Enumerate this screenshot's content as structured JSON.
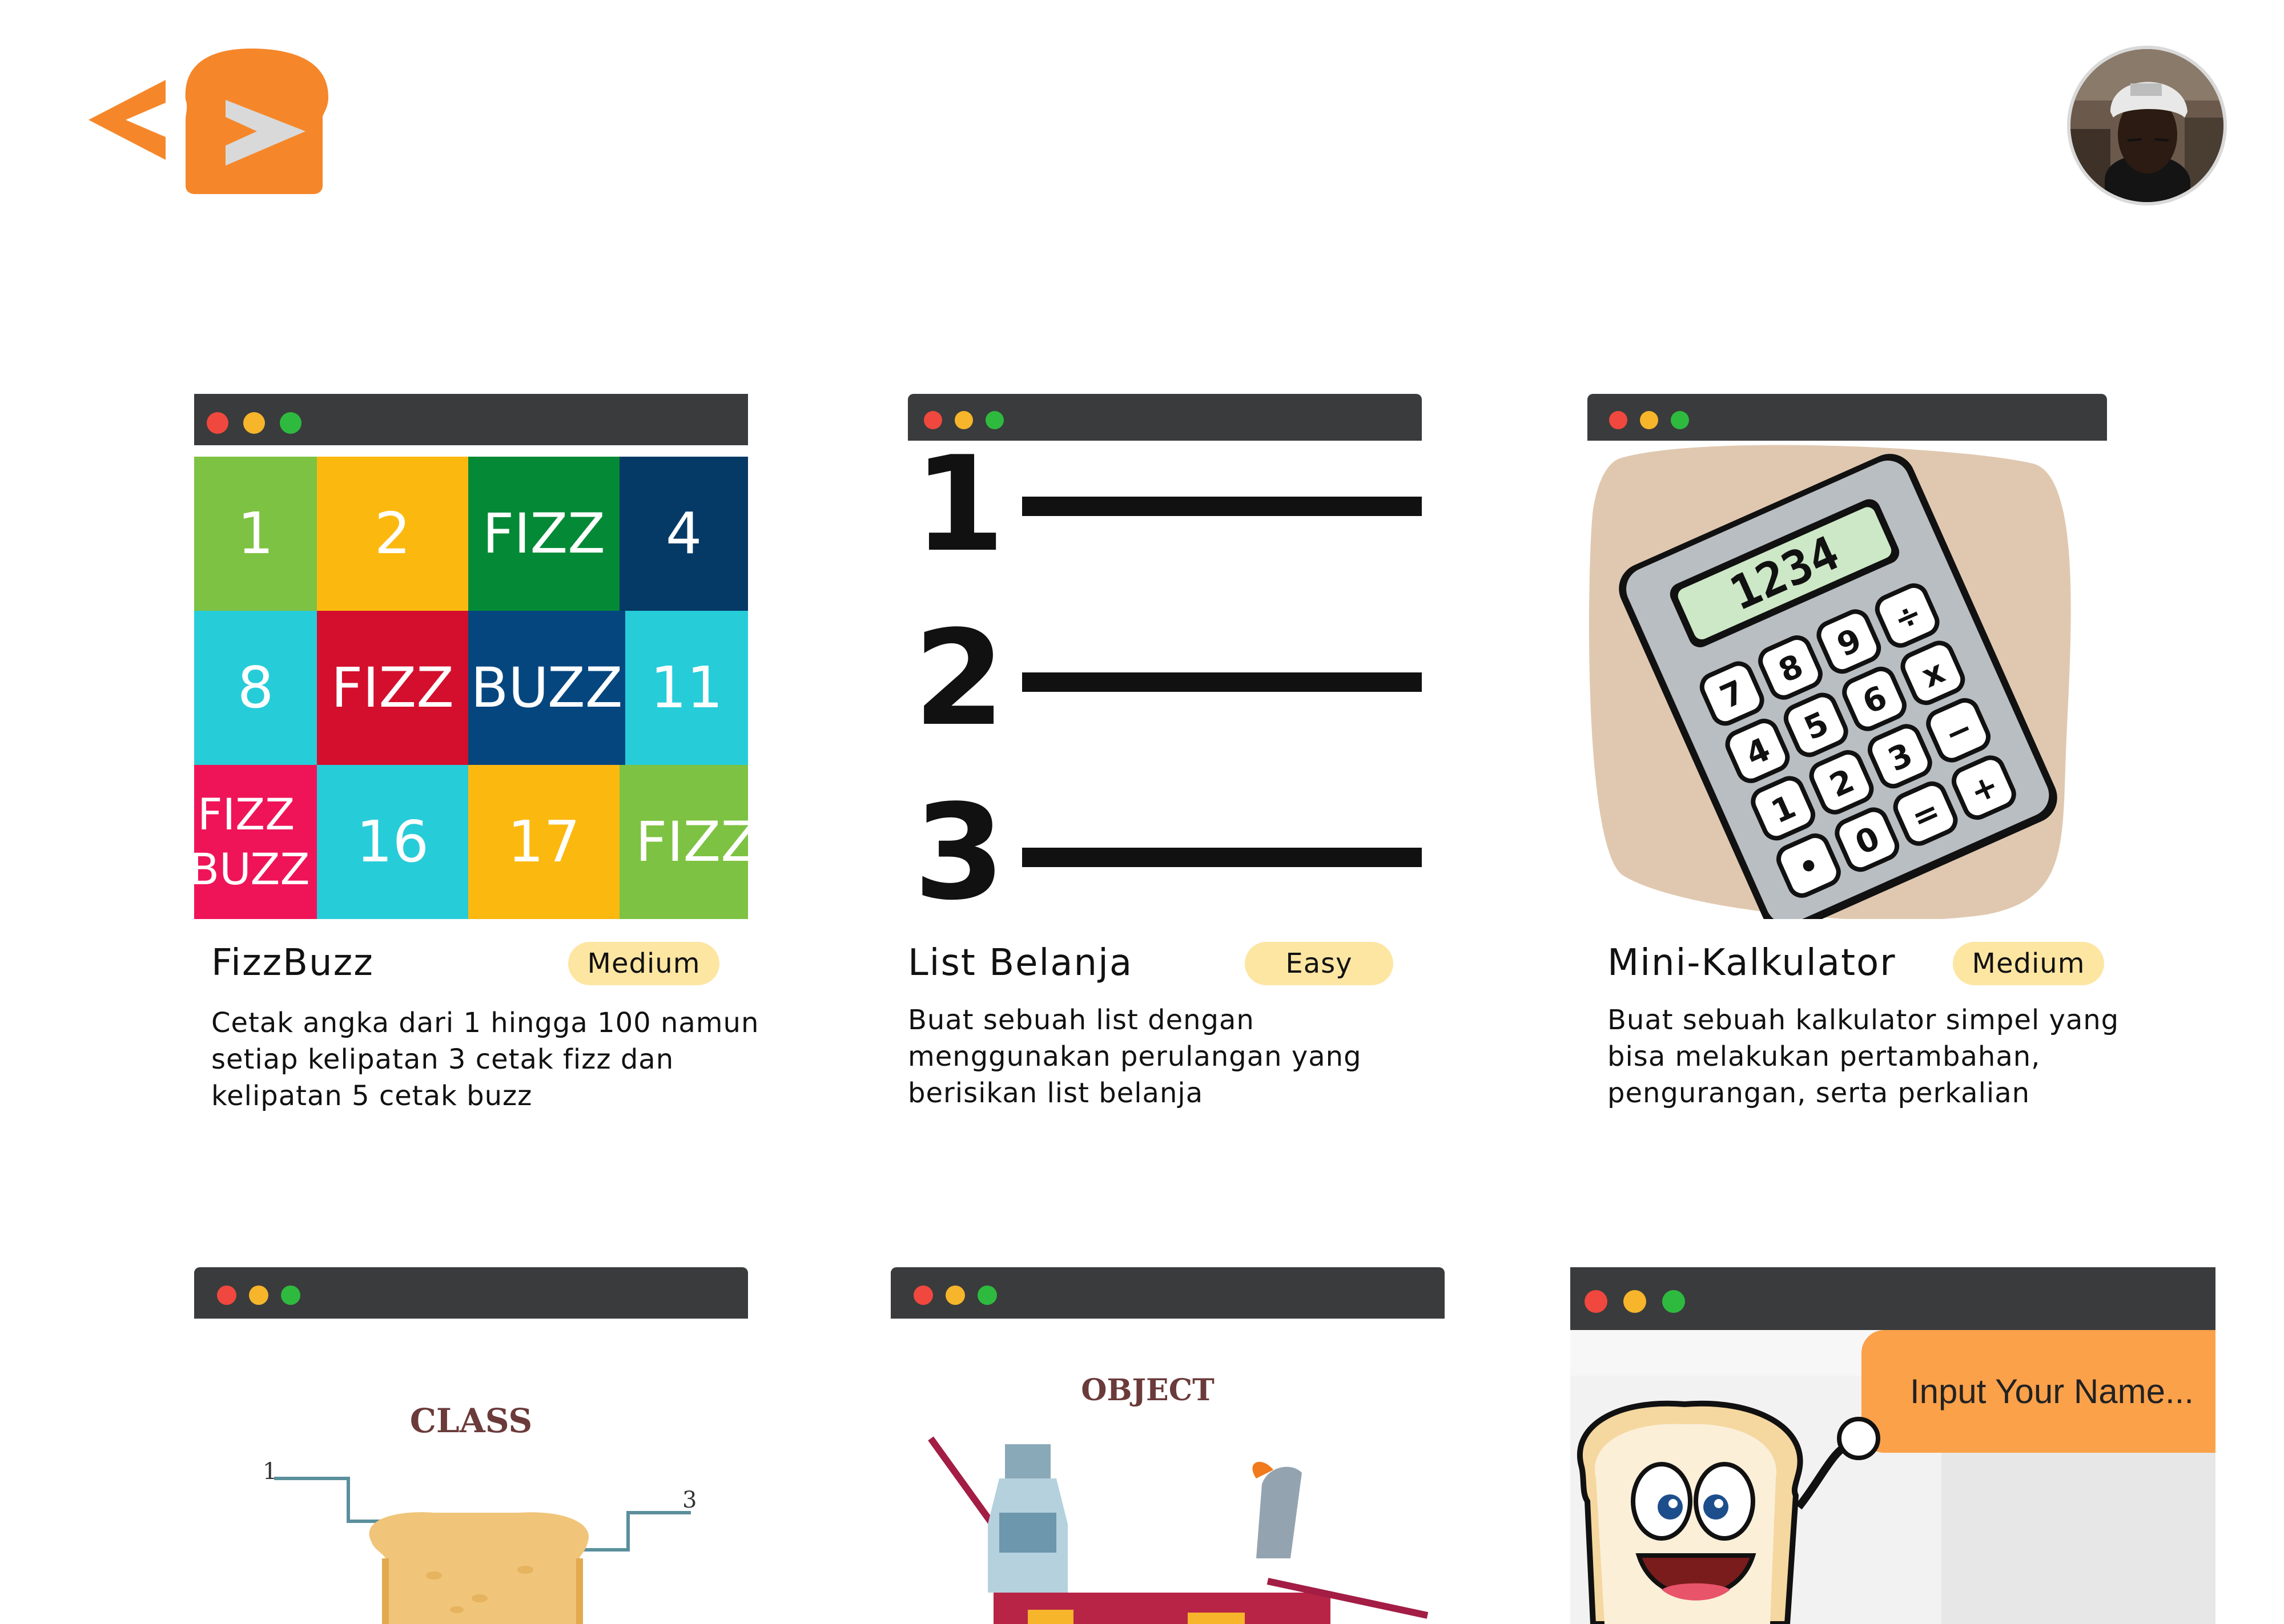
{
  "header": {
    "logo_icon": "code-bread-logo",
    "avatar_icon": "user-avatar"
  },
  "cards": [
    {
      "title": "FizzBuzz",
      "difficulty": "Medium",
      "description_lines": [
        "Cetak angka dari 1 hingga 100 namun",
        "setiap kelipatan 3 cetak fizz dan",
        "kelipatan 5 cetak buzz"
      ],
      "thumbnail": {
        "cells": [
          "1",
          "2",
          "FIZZ",
          "4",
          "8",
          "FIZZ",
          "BUZZ",
          "11",
          "FIZZ",
          "BUZZ",
          "16",
          "17",
          "FIZZ"
        ]
      }
    },
    {
      "title": "List Belanja",
      "difficulty": "Easy",
      "description_lines": [
        "Buat sebuah list dengan",
        "menggunakan perulangan yang",
        "berisikan list belanja"
      ],
      "thumbnail": {
        "numbers": [
          "1",
          "2",
          "3"
        ]
      }
    },
    {
      "title": "Mini-Kalkulator",
      "difficulty": "Medium",
      "description_lines": [
        "Buat sebuah kalkulator simpel yang",
        "bisa melakukan pertambahan,",
        "pengurangan, serta perkalian"
      ],
      "thumbnail": {
        "display": "1234",
        "keys": [
          "7",
          "8",
          "9",
          "÷",
          "4",
          "5",
          "6",
          "x",
          "1",
          "2",
          "3",
          "−",
          "•",
          "0",
          "=",
          "+"
        ]
      }
    },
    {
      "thumbnail": {
        "heading": "CLASS",
        "label_left": "1",
        "label_right": "3"
      }
    },
    {
      "thumbnail": {
        "heading": "OBJECT"
      }
    },
    {
      "thumbnail": {
        "input_text": "Input Your Name..."
      }
    }
  ],
  "colors": {
    "brand_orange": "#f5872a",
    "badge_yellow": "#fde6a2",
    "window_bar": "#3a3b3c"
  }
}
